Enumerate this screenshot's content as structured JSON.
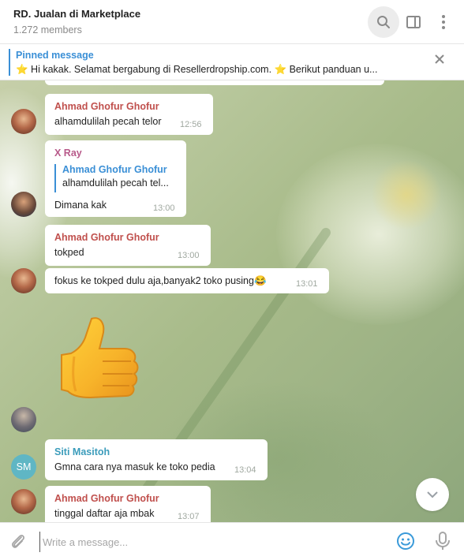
{
  "header": {
    "title": "RD. Jualan di Marketplace",
    "subtitle": "1.272 members"
  },
  "pinned": {
    "title": "Pinned message",
    "text": "⭐ Hi kakak. Selamat bergabung di Resellerdropship.com. ⭐  Berikut panduan u..."
  },
  "messages": [
    {
      "sender": "Ahmad Ghofur Ghofur",
      "text": "alhamdulilah pecah telor",
      "time": "12:56"
    },
    {
      "sender": "X Ray",
      "reply_name": "Ahmad Ghofur Ghofur",
      "reply_text": "alhamdulilah pecah tel...",
      "text": "Dimana kak",
      "time": "13:00"
    },
    {
      "sender": "Ahmad Ghofur Ghofur",
      "text": "tokped",
      "time": "13:00"
    },
    {
      "text": "fokus ke tokped dulu aja,banyak2 toko pusing😂",
      "time": "13:01"
    },
    {
      "sender": "Siti Masitoh",
      "avatar_initials": "SM",
      "text": "Gmna cara nya masuk ke toko pedia",
      "time": "13:04"
    },
    {
      "sender": "Ahmad Ghofur Ghofur",
      "text": "tinggal daftar aja mbak",
      "time": "13:07"
    }
  ],
  "composer": {
    "placeholder": "Write a message..."
  },
  "colors": {
    "accent": "#3a8fd6",
    "sender_red": "#c0504d",
    "sender_pink": "#b85a8a",
    "sender_blue": "#3b9cbb",
    "avatar_sm": "#5fb6c4"
  },
  "icons": {
    "search": "search-icon",
    "panel": "side-panel-icon",
    "more": "more-vertical-icon",
    "close": "close-icon",
    "attach": "paperclip-icon",
    "emoji": "emoji-icon",
    "mic": "microphone-icon",
    "scroll": "chevron-down-icon",
    "sticker": "thumbs-up-sticker"
  }
}
